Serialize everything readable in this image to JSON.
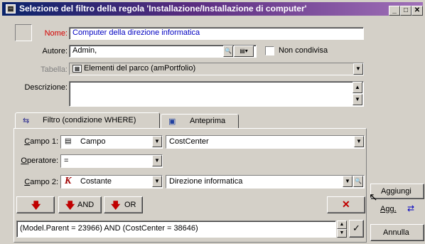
{
  "window": {
    "title": "Selezione del filtro della regola 'Installazione/Installazione di computer'"
  },
  "form": {
    "nome_label": "Nome:",
    "nome_value": "Computer della direzione informatica",
    "autore_label": "Autore:",
    "autore_value": "Admin,",
    "non_condivisa_label": "Non condivisa",
    "tabella_label": "Tabella:",
    "tabella_value": "Elementi del parco (amPortfolio)",
    "descrizione_label": "Descrizione:"
  },
  "tabs": [
    {
      "label": "Filtro (condizione WHERE)"
    },
    {
      "label": "Anteprima"
    }
  ],
  "filter": {
    "campo1_label": "Campo 1:",
    "campo1_type": "Campo",
    "campo1_value": "CostCenter",
    "operatore_label": "Operatore:",
    "operatore_value": "=",
    "campo2_label": "Campo 2:",
    "campo2_type": "Costante",
    "campo2_value": "Direzione informatica",
    "and_label": "AND",
    "or_label": "OR",
    "expression": "(Model.Parent = 23966) AND (CostCenter = 38646)"
  },
  "buttons": {
    "aggiungi": "Aggiungi",
    "agg": "Agg.",
    "annulla": "Annulla"
  }
}
